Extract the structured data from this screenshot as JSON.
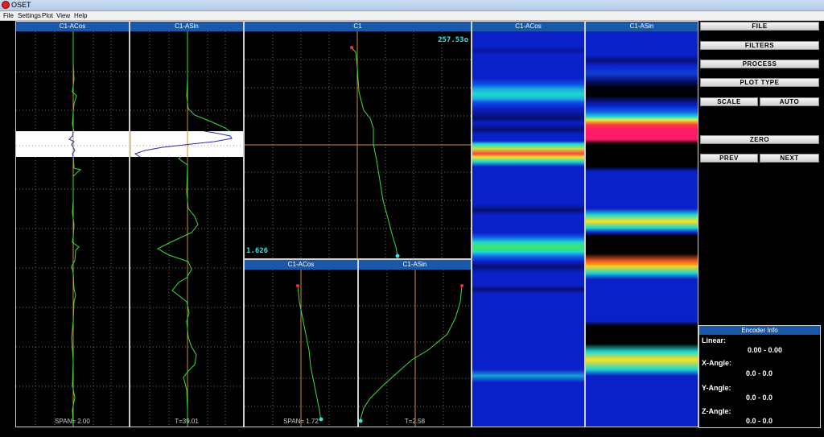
{
  "window": {
    "title": "OSET"
  },
  "menu": [
    "File",
    "Settings",
    "Plot",
    "View",
    "Help"
  ],
  "panels": {
    "p1": {
      "title": "C1-ACos",
      "footer": "SPAN= 2.00"
    },
    "p2": {
      "title": "C1-ASin",
      "footer": "T=39.01"
    },
    "p3": {
      "title": "C1",
      "top_value": "257.53o",
      "bottom_value": "1.626"
    },
    "p4": {
      "title": "C1-ACos",
      "footer": "SPAN= 1.72"
    },
    "p5": {
      "title": "C1-ASin",
      "footer": "T=2.58"
    },
    "p6": {
      "title": "C1-ACos"
    },
    "p7": {
      "title": "C1-ASin"
    }
  },
  "buttons": {
    "file": "FILE",
    "filters": "FILTERS",
    "process": "PROCESS",
    "plot_type": "PLOT TYPE",
    "scale": "SCALE",
    "auto": "AUTO",
    "zero": "ZERO",
    "prev": "PREV",
    "next": "NEXT"
  },
  "encoder": {
    "title": "Encoder Info",
    "linear_label": "Linear:",
    "linear_value": "0.00 -  0.00",
    "x_label": "X-Angle:",
    "x_value": "0.0 -  0.0",
    "y_label": "Y-Angle:",
    "y_value": "0.0 -  0.0",
    "z_label": "Z-Angle:",
    "z_value": "0.0 -  0.0"
  },
  "colors": {
    "trace": "#3ddc3d",
    "header": "#1b59a8",
    "cursor": "#c8902a",
    "value_text": "#36e2e6",
    "marker_start": "#ff2a2a",
    "marker_end": "#36e2e6",
    "grid": "#6a6a6a"
  }
}
